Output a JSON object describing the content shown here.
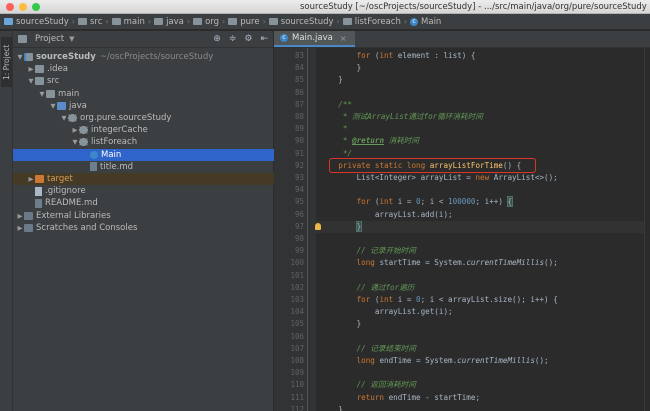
{
  "window": {
    "title": "sourceStudy [~/oscProjects/sourceStudy] - .../src/main/java/org/pure/sourceStudy"
  },
  "breadcrumbs": [
    "sourceStudy",
    "src",
    "main",
    "java",
    "org",
    "pure",
    "sourceStudy",
    "listForeach",
    "Main"
  ],
  "left_strip": {
    "project_tab": "1: Project"
  },
  "project_panel": {
    "title": "Project",
    "tree": [
      {
        "label": "sourceStudy",
        "extra": "~/oscProjects/sourceStudy",
        "depth": 0,
        "arrow": "▼",
        "icon": "module-icon",
        "state": "normal"
      },
      {
        "label": ".idea",
        "extra": "",
        "depth": 1,
        "arrow": "▶",
        "icon": "folder-icon",
        "state": "normal"
      },
      {
        "label": "src",
        "extra": "",
        "depth": 1,
        "arrow": "▼",
        "icon": "folder-icon",
        "state": "normal"
      },
      {
        "label": "main",
        "extra": "",
        "depth": 2,
        "arrow": "▼",
        "icon": "folder-icon",
        "state": "normal"
      },
      {
        "label": "java",
        "extra": "",
        "depth": 3,
        "arrow": "▼",
        "icon": "source-folder-icon",
        "state": "normal"
      },
      {
        "label": "org.pure.sourceStudy",
        "extra": "",
        "depth": 4,
        "arrow": "▼",
        "icon": "package-icon",
        "state": "normal"
      },
      {
        "label": "integerCache",
        "extra": "",
        "depth": 5,
        "arrow": "▶",
        "icon": "package-icon",
        "state": "normal"
      },
      {
        "label": "listForeach",
        "extra": "",
        "depth": 5,
        "arrow": "▼",
        "icon": "package-icon",
        "state": "normal"
      },
      {
        "label": "Main",
        "extra": "",
        "depth": 6,
        "arrow": "",
        "icon": "class-icon",
        "state": "selected"
      },
      {
        "label": "title.md",
        "extra": "",
        "depth": 6,
        "arrow": "",
        "icon": "markdown-file-icon",
        "state": "normal"
      },
      {
        "label": "target",
        "extra": "",
        "depth": 1,
        "arrow": "▶",
        "icon": "excluded-folder-icon",
        "state": "excluded"
      },
      {
        "label": ".gitignore",
        "extra": "",
        "depth": 1,
        "arrow": "",
        "icon": "file-icon",
        "state": "normal"
      },
      {
        "label": "README.md",
        "extra": "",
        "depth": 1,
        "arrow": "",
        "icon": "markdown-file-icon",
        "state": "normal"
      },
      {
        "label": "External Libraries",
        "extra": "",
        "depth": 0,
        "arrow": "▶",
        "icon": "library-icon",
        "state": "normal"
      },
      {
        "label": "Scratches and Consoles",
        "extra": "",
        "depth": 0,
        "arrow": "▶",
        "icon": "scratches-icon",
        "state": "normal"
      }
    ]
  },
  "editor": {
    "tab_label": "Main.java",
    "line_numbers": [
      "83",
      "84",
      "85",
      "86",
      "87",
      "88",
      "89",
      "90",
      "91",
      "92",
      "93",
      "94",
      "95",
      "96",
      "97",
      "98",
      "99",
      "100",
      "101",
      "102",
      "103",
      "104",
      "105",
      "106",
      "107",
      "108",
      "109",
      "110",
      "111",
      "112"
    ],
    "code_lines": [
      [
        {
          "t": "        "
        },
        {
          "t": "for",
          "c": "kw"
        },
        {
          "t": " ("
        },
        {
          "t": "int",
          "c": "kw"
        },
        {
          "t": " element : list) {"
        }
      ],
      [
        {
          "t": "        }"
        }
      ],
      [
        {
          "t": "    }"
        }
      ],
      [
        {
          "t": ""
        }
      ],
      [
        {
          "t": "    /**",
          "c": "cm"
        }
      ],
      [
        {
          "t": "     * 测试ArrayList通过for循环消耗时间",
          "c": "cm"
        }
      ],
      [
        {
          "t": "     *",
          "c": "cm"
        }
      ],
      [
        {
          "t": "     * ",
          "c": "cm"
        },
        {
          "t": "@return",
          "c": "tag"
        },
        {
          "t": " 消耗时间",
          "c": "cm"
        }
      ],
      [
        {
          "t": "     */",
          "c": "cm"
        }
      ],
      [
        {
          "t": "    "
        },
        {
          "t": "private static long ",
          "c": "kw"
        },
        {
          "t": "arrayListForTime",
          "c": "fn"
        },
        {
          "t": "() {"
        }
      ],
      [
        {
          "t": "        List<Integer> arrayList = "
        },
        {
          "t": "new ",
          "c": "kw"
        },
        {
          "t": "ArrayList<>();"
        }
      ],
      [
        {
          "t": ""
        }
      ],
      [
        {
          "t": "        "
        },
        {
          "t": "for",
          "c": "kw"
        },
        {
          "t": " ("
        },
        {
          "t": "int",
          "c": "kw"
        },
        {
          "t": " i = "
        },
        {
          "t": "0",
          "c": "num"
        },
        {
          "t": "; i < "
        },
        {
          "t": "100000",
          "c": "num"
        },
        {
          "t": "; i++) "
        },
        {
          "t": "{",
          "c": "bh"
        }
      ],
      [
        {
          "t": "            arrayList.add(i);"
        }
      ],
      [
        {
          "t": "        "
        },
        {
          "t": "}",
          "c": "bh"
        }
      ],
      [
        {
          "t": ""
        }
      ],
      [
        {
          "t": "        "
        },
        {
          "t": "// 记录开始时间",
          "c": "cm"
        }
      ],
      [
        {
          "t": "        "
        },
        {
          "t": "long",
          "c": "kw"
        },
        {
          "t": " startTime = System."
        },
        {
          "t": "currentTimeMillis",
          "c": "it"
        },
        {
          "t": "();"
        }
      ],
      [
        {
          "t": ""
        }
      ],
      [
        {
          "t": "        "
        },
        {
          "t": "// 通过for遍历",
          "c": "cm"
        }
      ],
      [
        {
          "t": "        "
        },
        {
          "t": "for",
          "c": "kw"
        },
        {
          "t": " ("
        },
        {
          "t": "int",
          "c": "kw"
        },
        {
          "t": " i = "
        },
        {
          "t": "0",
          "c": "num"
        },
        {
          "t": "; i < arrayList.size(); i++) {"
        }
      ],
      [
        {
          "t": "            arrayList.get(i);"
        }
      ],
      [
        {
          "t": "        }"
        }
      ],
      [
        {
          "t": ""
        }
      ],
      [
        {
          "t": "        "
        },
        {
          "t": "// 记录结束时间",
          "c": "cm"
        }
      ],
      [
        {
          "t": "        "
        },
        {
          "t": "long",
          "c": "kw"
        },
        {
          "t": " endTime = System."
        },
        {
          "t": "currentTimeMillis",
          "c": "it"
        },
        {
          "t": "();"
        }
      ],
      [
        {
          "t": ""
        }
      ],
      [
        {
          "t": "        "
        },
        {
          "t": "// 返回消耗时间",
          "c": "cm"
        }
      ],
      [
        {
          "t": "        "
        },
        {
          "t": "return",
          "c": "kw"
        },
        {
          "t": " endTime - startTime;"
        }
      ],
      [
        {
          "t": "    }"
        }
      ]
    ]
  },
  "colors": {
    "selection": "#2f65ca",
    "highlight_box": "#d8362a",
    "keyword": "#cc7832",
    "comment": "#629755",
    "method": "#ffc66d"
  }
}
